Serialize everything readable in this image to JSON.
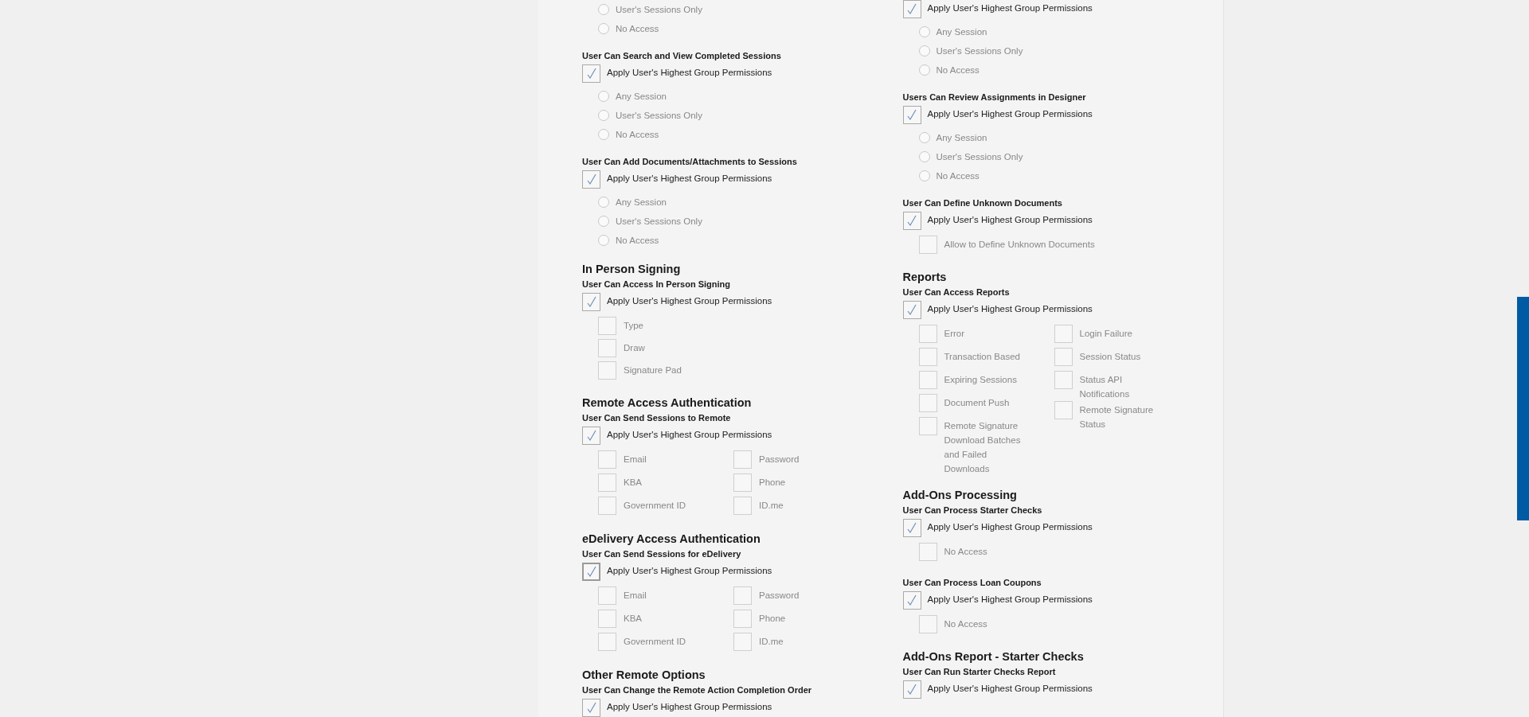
{
  "columns": [
    {
      "blocks": [
        {
          "kind": "permission",
          "options": {
            "kind": "radio",
            "items": [
              {
                "label": "User's Sessions Only",
                "selected": false
              },
              {
                "label": "No Access",
                "selected": false
              }
            ]
          }
        },
        {
          "kind": "permission",
          "title": "User Can Search and View Completed Sessions",
          "apply": {
            "label": "Apply User's Highest Group Permissions",
            "checked": true,
            "focused": false
          },
          "options": {
            "kind": "radio",
            "items": [
              {
                "label": "Any Session",
                "selected": false
              },
              {
                "label": "User's Sessions Only",
                "selected": false
              },
              {
                "label": "No Access",
                "selected": false
              }
            ]
          }
        },
        {
          "kind": "permission",
          "title": "User Can Add Documents/Attachments to Sessions",
          "apply": {
            "label": "Apply User's Highest Group Permissions",
            "checked": true,
            "focused": false
          },
          "options": {
            "kind": "radio",
            "items": [
              {
                "label": "Any Session",
                "selected": false
              },
              {
                "label": "User's Sessions Only",
                "selected": false
              },
              {
                "label": "No Access",
                "selected": false
              }
            ]
          }
        },
        {
          "kind": "section",
          "title": "In Person Signing"
        },
        {
          "kind": "permission",
          "title": "User Can Access In Person Signing",
          "apply": {
            "label": "Apply User's Highest Group Permissions",
            "checked": true,
            "focused": false
          },
          "options": {
            "kind": "checkbox",
            "items": [
              {
                "label": "Type",
                "checked": false
              },
              {
                "label": "Draw",
                "checked": false
              },
              {
                "label": "Signature Pad",
                "checked": false
              }
            ]
          }
        },
        {
          "kind": "section",
          "title": "Remote Access Authentication"
        },
        {
          "kind": "permission",
          "title": "User Can Send Sessions to Remote",
          "apply": {
            "label": "Apply User's Highest Group Permissions",
            "checked": true,
            "focused": false
          },
          "options": {
            "kind": "grid",
            "columns": [
              [
                {
                  "label": "Email",
                  "checked": false
                },
                {
                  "label": "KBA",
                  "checked": false
                },
                {
                  "label": "Government ID",
                  "checked": false
                }
              ],
              [
                {
                  "label": "Password",
                  "checked": false
                },
                {
                  "label": "Phone",
                  "checked": false
                },
                {
                  "label": "ID.me",
                  "checked": false
                }
              ]
            ]
          }
        },
        {
          "kind": "section",
          "title": "eDelivery Access Authentication"
        },
        {
          "kind": "permission",
          "title": "User Can Send Sessions for eDelivery",
          "apply": {
            "label": "Apply User's Highest Group Permissions",
            "checked": true,
            "focused": true
          },
          "options": {
            "kind": "grid",
            "columns": [
              [
                {
                  "label": "Email",
                  "checked": false
                },
                {
                  "label": "KBA",
                  "checked": false
                },
                {
                  "label": "Government ID",
                  "checked": false
                }
              ],
              [
                {
                  "label": "Password",
                  "checked": false
                },
                {
                  "label": "Phone",
                  "checked": false
                },
                {
                  "label": "ID.me",
                  "checked": false
                }
              ]
            ]
          }
        },
        {
          "kind": "section",
          "title": "Other Remote Options"
        },
        {
          "kind": "permission",
          "title": "User Can Change the Remote Action Completion Order",
          "apply": {
            "label": "Apply User's Highest Group Permissions",
            "checked": true,
            "focused": false
          }
        }
      ]
    },
    {
      "blocks": [
        {
          "kind": "permission",
          "apply": {
            "label": "Apply User's Highest Group Permissions",
            "checked": true,
            "focused": false
          },
          "options": {
            "kind": "radio",
            "items": [
              {
                "label": "Any Session",
                "selected": false
              },
              {
                "label": "User's Sessions Only",
                "selected": false
              },
              {
                "label": "No Access",
                "selected": false
              }
            ]
          }
        },
        {
          "kind": "permission",
          "title": "Users Can Review Assignments in Designer",
          "apply": {
            "label": "Apply User's Highest Group Permissions",
            "checked": true,
            "focused": false
          },
          "options": {
            "kind": "radio",
            "items": [
              {
                "label": "Any Session",
                "selected": false
              },
              {
                "label": "User's Sessions Only",
                "selected": false
              },
              {
                "label": "No Access",
                "selected": false
              }
            ]
          }
        },
        {
          "kind": "permission",
          "title": "User Can Define Unknown Documents",
          "apply": {
            "label": "Apply User's Highest Group Permissions",
            "checked": true,
            "focused": false
          },
          "options": {
            "kind": "checkbox",
            "items": [
              {
                "label": "Allow to Define Unknown Documents",
                "checked": false
              }
            ]
          }
        },
        {
          "kind": "section",
          "title": "Reports"
        },
        {
          "kind": "permission",
          "title": "User Can Access Reports",
          "apply": {
            "label": "Apply User's Highest Group Permissions",
            "checked": true,
            "focused": false
          },
          "options": {
            "kind": "grid",
            "columns": [
              [
                {
                  "label": "Error",
                  "checked": false
                },
                {
                  "label": "Transaction Based",
                  "checked": false
                },
                {
                  "label": "Expiring Sessions",
                  "checked": false
                },
                {
                  "label": "Document Push",
                  "checked": false
                },
                {
                  "label": "Remote Signature Download Batches and Failed Downloads",
                  "checked": false
                }
              ],
              [
                {
                  "label": "Login Failure",
                  "checked": false
                },
                {
                  "label": "Session Status",
                  "checked": false
                },
                {
                  "label": "Status API Notifications",
                  "checked": false
                },
                {
                  "label": "Remote Signature Status",
                  "checked": false
                }
              ]
            ]
          }
        },
        {
          "kind": "section",
          "title": "Add-Ons Processing"
        },
        {
          "kind": "permission",
          "title": "User Can Process Starter Checks",
          "apply": {
            "label": "Apply User's Highest Group Permissions",
            "checked": true,
            "focused": false
          },
          "options": {
            "kind": "checkbox",
            "items": [
              {
                "label": "No Access",
                "checked": false
              }
            ]
          }
        },
        {
          "kind": "permission",
          "title": "User Can Process Loan Coupons",
          "apply": {
            "label": "Apply User's Highest Group Permissions",
            "checked": true,
            "focused": false
          },
          "options": {
            "kind": "checkbox",
            "items": [
              {
                "label": "No Access",
                "checked": false
              }
            ]
          }
        },
        {
          "kind": "section",
          "title": "Add-Ons Report - Starter Checks"
        },
        {
          "kind": "permission",
          "title": "User Can Run Starter Checks Report",
          "apply": {
            "label": "Apply User's Highest Group Permissions",
            "checked": true,
            "focused": false
          }
        }
      ]
    }
  ]
}
